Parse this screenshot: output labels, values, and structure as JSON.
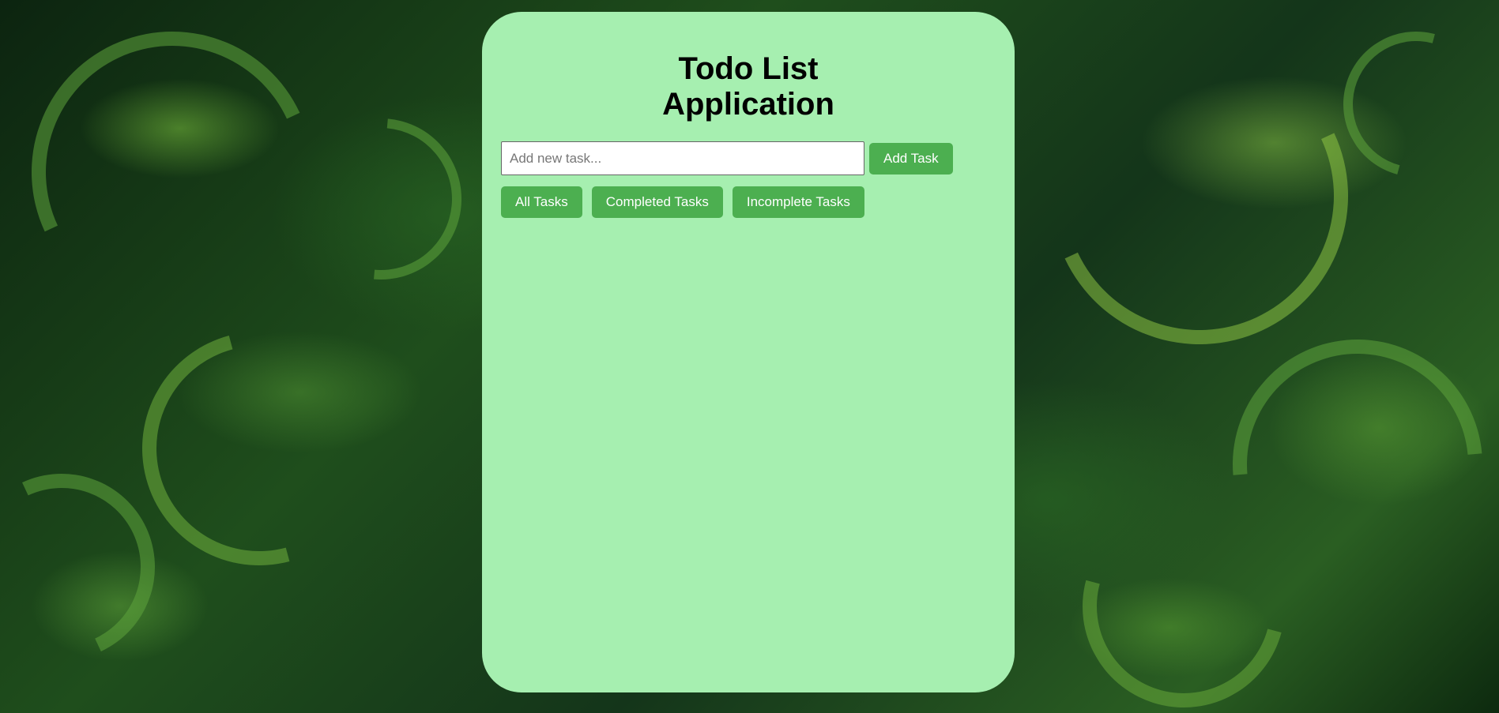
{
  "app": {
    "title": "Todo List Application"
  },
  "input": {
    "placeholder": "Add new task...",
    "value": ""
  },
  "buttons": {
    "add": "Add Task",
    "all": "All Tasks",
    "completed": "Completed Tasks",
    "incomplete": "Incomplete Tasks"
  },
  "tasks": [],
  "colors": {
    "card_background": "#a6efb0",
    "button": "#4caf50",
    "button_text": "#ffffff"
  }
}
